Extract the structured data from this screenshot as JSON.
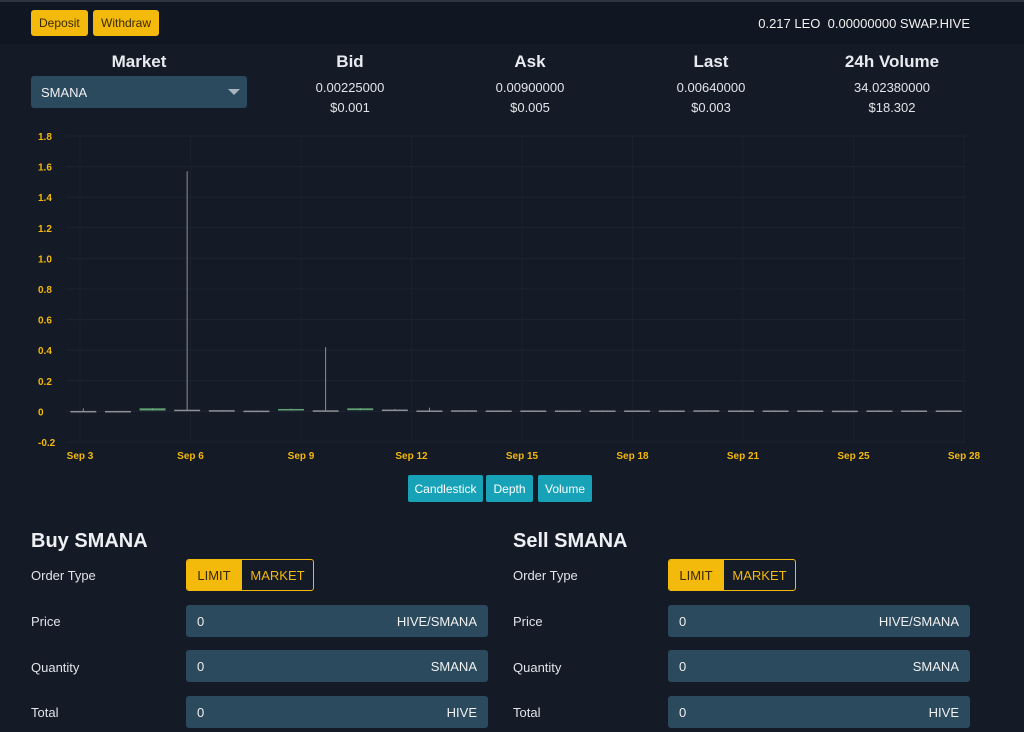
{
  "topbar": {
    "deposit_label": "Deposit",
    "withdraw_label": "Withdraw",
    "leo_balance": "0.217 LEO",
    "swaphive_balance": "0.00000000 SWAP.HIVE"
  },
  "market": {
    "heading": "Market",
    "selected": "SMANA"
  },
  "stats": {
    "bid": {
      "heading": "Bid",
      "value": "0.00225000",
      "usd": "$0.001"
    },
    "ask": {
      "heading": "Ask",
      "value": "0.00900000",
      "usd": "$0.005"
    },
    "last": {
      "heading": "Last",
      "value": "0.00640000",
      "usd": "$0.003"
    },
    "volume": {
      "heading": "24h Volume",
      "value": "34.02380000",
      "usd": "$18.302"
    }
  },
  "chart_data": {
    "type": "candlestick",
    "y_ticks": [
      "1.8",
      "1.6",
      "1.4",
      "1.2",
      "1.0",
      "0.8",
      "0.6",
      "0.4",
      "0.2",
      "0",
      "-0.2"
    ],
    "ylim": [
      -0.2,
      1.8
    ],
    "x_ticks": [
      "Sep 3",
      "Sep 6",
      "Sep 9",
      "Sep 12",
      "Sep 15",
      "Sep 18",
      "Sep 21",
      "Sep 25",
      "Sep 28"
    ],
    "grid": true,
    "candles": [
      {
        "open": 0.003,
        "close": 0.002,
        "high": 0.02,
        "low": 0.0,
        "up": false
      },
      {
        "open": 0.003,
        "close": 0.002,
        "high": 0.004,
        "low": 0.001,
        "up": false
      },
      {
        "open": 0.006,
        "close": 0.02,
        "high": 0.022,
        "low": 0.005,
        "up": true
      },
      {
        "open": 0.011,
        "close": 0.009,
        "high": 1.57,
        "low": 0.005,
        "up": false
      },
      {
        "open": 0.008,
        "close": 0.007,
        "high": 0.009,
        "low": 0.006,
        "up": false
      },
      {
        "open": 0.005,
        "close": 0.004,
        "high": 0.006,
        "low": 0.003,
        "up": false
      },
      {
        "open": 0.006,
        "close": 0.016,
        "high": 0.018,
        "low": 0.005,
        "up": true
      },
      {
        "open": 0.007,
        "close": 0.006,
        "high": 0.42,
        "low": 0.003,
        "up": false
      },
      {
        "open": 0.008,
        "close": 0.02,
        "high": 0.022,
        "low": 0.006,
        "up": true
      },
      {
        "open": 0.012,
        "close": 0.01,
        "high": 0.016,
        "low": 0.008,
        "up": false
      },
      {
        "open": 0.006,
        "close": 0.005,
        "high": 0.025,
        "low": 0.004,
        "up": false
      },
      {
        "open": 0.007,
        "close": 0.006,
        "high": 0.008,
        "low": 0.005,
        "up": false
      },
      {
        "open": 0.006,
        "close": 0.005,
        "high": 0.007,
        "low": 0.004,
        "up": false
      },
      {
        "open": 0.006,
        "close": 0.005,
        "high": 0.007,
        "low": 0.004,
        "up": false
      },
      {
        "open": 0.006,
        "close": 0.005,
        "high": 0.007,
        "low": 0.004,
        "up": false
      },
      {
        "open": 0.006,
        "close": 0.005,
        "high": 0.007,
        "low": 0.004,
        "up": false
      },
      {
        "open": 0.006,
        "close": 0.005,
        "high": 0.007,
        "low": 0.004,
        "up": false
      },
      {
        "open": 0.006,
        "close": 0.005,
        "high": 0.007,
        "low": 0.004,
        "up": false
      },
      {
        "open": 0.007,
        "close": 0.006,
        "high": 0.008,
        "low": 0.005,
        "up": false
      },
      {
        "open": 0.006,
        "close": 0.004,
        "high": 0.008,
        "low": 0.003,
        "up": false
      },
      {
        "open": 0.006,
        "close": 0.005,
        "high": 0.007,
        "low": 0.004,
        "up": false
      },
      {
        "open": 0.006,
        "close": 0.004,
        "high": 0.007,
        "low": 0.003,
        "up": false
      },
      {
        "open": 0.005,
        "close": 0.004,
        "high": 0.006,
        "low": 0.003,
        "up": false
      },
      {
        "open": 0.006,
        "close": 0.005,
        "high": 0.007,
        "low": 0.004,
        "up": false
      },
      {
        "open": 0.006,
        "close": 0.002,
        "high": 0.007,
        "low": 0.001,
        "up": false
      },
      {
        "open": 0.006,
        "close": 0.005,
        "high": 0.007,
        "low": 0.004,
        "up": false
      }
    ],
    "colors": {
      "up": "#5fa374",
      "down": "#8d9096"
    }
  },
  "chart_buttons": {
    "candlestick": "Candlestick",
    "depth": "Depth",
    "volume": "Volume"
  },
  "buy": {
    "title": "Buy SMANA",
    "order_type_label": "Order Type",
    "limit_label": "LIMIT",
    "market_label": "MARKET",
    "price_label": "Price",
    "price_value": "0",
    "price_unit": "HIVE/SMANA",
    "quantity_label": "Quantity",
    "quantity_value": "0",
    "quantity_unit": "SMANA",
    "total_label": "Total",
    "total_value": "0",
    "total_unit": "HIVE"
  },
  "sell": {
    "title": "Sell SMANA",
    "order_type_label": "Order Type",
    "limit_label": "LIMIT",
    "market_label": "MARKET",
    "price_label": "Price",
    "price_value": "0",
    "price_unit": "HIVE/SMANA",
    "quantity_label": "Quantity",
    "quantity_value": "0",
    "quantity_unit": "SMANA",
    "total_label": "Total",
    "total_value": "0",
    "total_unit": "HIVE"
  },
  "theme": {
    "accent": "#f3b90b",
    "teal": "#17a2b8",
    "field_bg": "#2c4a5d",
    "page_bg": "#141a26"
  }
}
